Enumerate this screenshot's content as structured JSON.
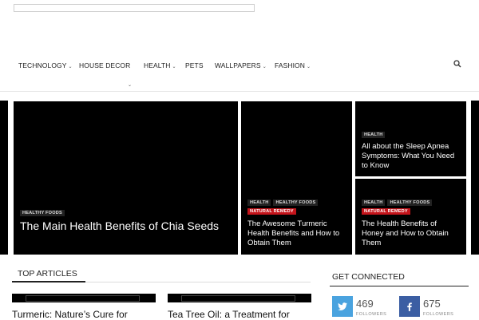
{
  "nav": {
    "items": [
      {
        "label": "TECHNOLOGY",
        "has_dropdown": true
      },
      {
        "label": "HOUSE DECOR",
        "has_dropdown": false
      },
      {
        "label": "HEALTH",
        "has_dropdown": true
      },
      {
        "label": "PETS",
        "has_dropdown": false
      },
      {
        "label": "WALLPAPERS",
        "has_dropdown": true
      },
      {
        "label": "FASHION",
        "has_dropdown": true
      }
    ]
  },
  "featured": {
    "big": {
      "tags": [
        "HEALTHY FOODS"
      ],
      "title": "The Main Health Benefits of Chia Seeds"
    },
    "mid": {
      "tags": [
        "HEALTH",
        "HEALTHY FOODS",
        "NATURAL REMEDY"
      ],
      "title": "The Awesome Turmeric Health Benefits and How to Obtain Them"
    },
    "small1": {
      "tags": [
        "HEALTH"
      ],
      "title": "All about the Sleep Apnea Symptoms: What You Need to Know"
    },
    "small2": {
      "tags": [
        "HEALTH",
        "HEALTHY FOODS",
        "NATURAL REMEDY"
      ],
      "title": "The Health Benefits of Honey and How to Obtain Them"
    }
  },
  "top_articles": {
    "heading": "TOP ARTICLES",
    "items": [
      {
        "title": "Turmeric: Nature’s Cure for"
      },
      {
        "title": "Tea Tree Oil: a Treatment for"
      }
    ]
  },
  "get_connected": {
    "heading": "GET CONNECTED",
    "twitter": {
      "count": "469",
      "label": "FOLLOWERS",
      "color": "#4aa3df"
    },
    "facebook": {
      "count": "675",
      "label": "FOLLOWERS",
      "color": "#3b5ea3"
    }
  },
  "colors": {
    "tag_red": "#c4141b",
    "tag_dark": "#222222"
  }
}
